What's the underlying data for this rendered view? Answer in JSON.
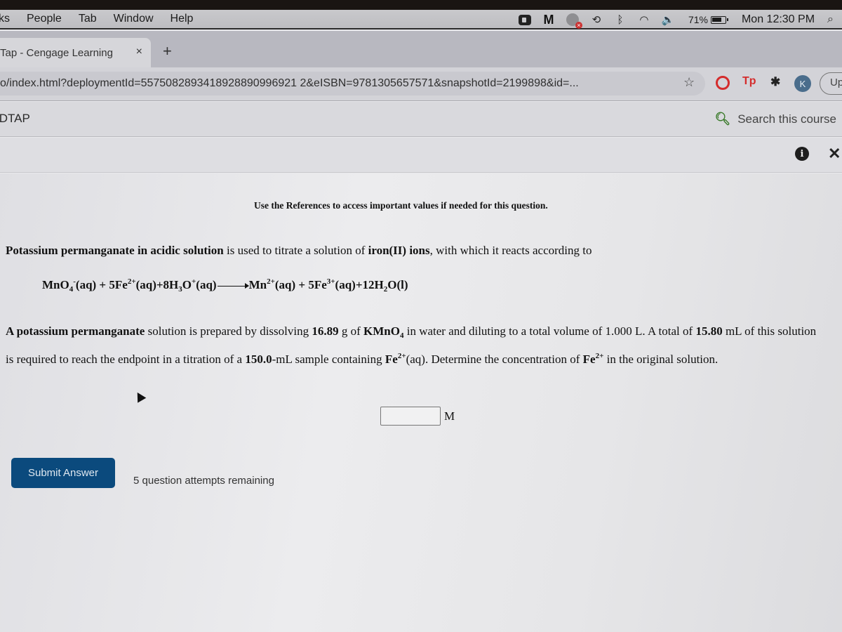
{
  "menubar": {
    "items": [
      "ks",
      "People",
      "Tab",
      "Window",
      "Help"
    ],
    "status": {
      "icons": [
        "zoom-icon",
        "malwarebytes-icon",
        "vpn-disconnected-icon",
        "time-machine-icon",
        "bluetooth-icon",
        "wifi-icon",
        "volume-icon"
      ],
      "battery_percent": "71%",
      "clock": "Mon 12:30 PM"
    }
  },
  "browser": {
    "tab_title": "Tap - Cengage Learning",
    "tab_close": "×",
    "new_tab": "+",
    "url": "o/index.html?deploymentId=5575082893418928890996921 2&eISBN=9781305657571&snapshotId=2199898&id=...",
    "avatar_initial": "K",
    "update_label": "Up",
    "extensions": [
      "adblock-icon",
      "tp-extension-icon",
      "extensions-puzzle-icon"
    ]
  },
  "app": {
    "brand": "IDTAP",
    "search_label": "Search this course"
  },
  "question": {
    "references_note": "Use the References to access important values if needed for this question.",
    "intro": {
      "bold1": "Potassium permanganate in acidic solution",
      "text1": " is used to titrate a solution of ",
      "bold2": "iron(II) ions",
      "text2": ", with which it reacts according to"
    },
    "equation": {
      "r1": "MnO",
      "r1_sub": "4",
      "r1_sup": "-",
      "r1_state": "(aq) + 5Fe",
      "r2_sup": "2+",
      "r2_state": "(aq)+8H",
      "r3_sub": "3",
      "r3_o": "O",
      "r3_sup": "+",
      "r3_state": "(aq)",
      "p1": "Mn",
      "p1_sup": "2+",
      "p1_state": "(aq) + 5Fe",
      "p2_sup": "3+",
      "p2_state": "(aq)+12H",
      "p3_sub": "2",
      "p3_rest": "O(l)"
    },
    "problem": {
      "b1": "A potassium permanganate",
      "t1": " solution is prepared by dissolving ",
      "b2": "16.89",
      "t2": " g of ",
      "b3": "KMnO",
      "b3_sub": "4",
      "t3": " in water and diluting to a total volume of 1.000 L. A total of ",
      "b4": "15.80",
      "t4": " mL of this solution is required to reach the endpoint in a titration of a ",
      "b5": "150.0",
      "t5": "-mL sample containing ",
      "b6": "Fe",
      "b6_sup": "2+",
      "t6": "(aq). Determine the concentration of ",
      "b7": "Fe",
      "b7_sup": "2+",
      "t7": " in the original solution."
    },
    "answer_value": "",
    "answer_unit": "M",
    "submit_label": "Submit Answer",
    "attempts_text": "5 question attempts remaining"
  }
}
